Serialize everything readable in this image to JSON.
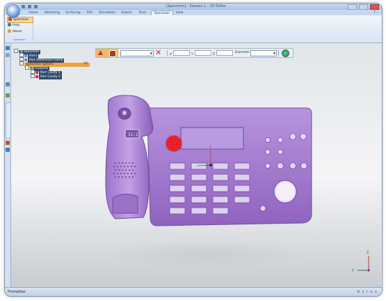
{
  "window": {
    "title": "[Specimen] - Session 1 - 3D Editor"
  },
  "ribbon": {
    "tabs": [
      "Home",
      "Sketching",
      "Surfacing",
      "FEA",
      "Simulation",
      "Export",
      "Tools",
      "Specimen",
      "View"
    ],
    "active_tab": "Specimen",
    "help": "? -",
    "group": {
      "label": "Specimen",
      "buttons": [
        "Specimen",
        "Help",
        "About"
      ]
    }
  },
  "tree": {
    "items": [
      {
        "label": "Specimen",
        "indent": 0
      },
      {
        "label": "Parts",
        "indent": 1
      },
      {
        "label": "Part Reference Frame",
        "indent": 1
      },
      {
        "label": "Specimen Sphere",
        "indent": 1,
        "selected": true,
        "badge": "(4)"
      },
      {
        "label": "Features",
        "indent": 2
      },
      {
        "label": "Part Cavity 1",
        "indent": 3
      },
      {
        "label": "Part Cavity 2",
        "indent": 3
      }
    ]
  },
  "command_bar": {
    "select_value": "",
    "x_label": "X",
    "y_label": "Y",
    "z_label": "Z",
    "diameter_label": "Diameter",
    "diameter_value": ""
  },
  "axes": {
    "x": "X",
    "y": "Y",
    "z": "Z"
  },
  "model": {
    "color": "#a57fd1",
    "marker_color": "#e8202b",
    "display_label": "11:1"
  },
  "status": {
    "prompt": "Promptbar",
    "icons": "A z r x x"
  }
}
